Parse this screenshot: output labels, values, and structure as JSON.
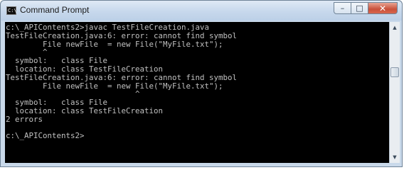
{
  "window": {
    "title": "Command Prompt",
    "icon_text": "C:\\",
    "minimize_glyph": "–",
    "maximize_glyph": "□",
    "close_glyph": "✕"
  },
  "console": {
    "lines": [
      "c:\\_APIContents2>javac TestFileCreation.java",
      "TestFileCreation.java:6: error: cannot find symbol",
      "        File newFile  = new File(\"MyFile.txt\");",
      "        ^",
      "  symbol:   class File",
      "  location: class TestFileCreation",
      "TestFileCreation.java:6: error: cannot find symbol",
      "        File newFile  = new File(\"MyFile.txt\");",
      "                            ^",
      "  symbol:   class File",
      "  location: class TestFileCreation",
      "2 errors",
      "",
      "c:\\_APIContents2>"
    ]
  },
  "scrollbar": {
    "up_glyph": "▲",
    "down_glyph": "▼"
  }
}
